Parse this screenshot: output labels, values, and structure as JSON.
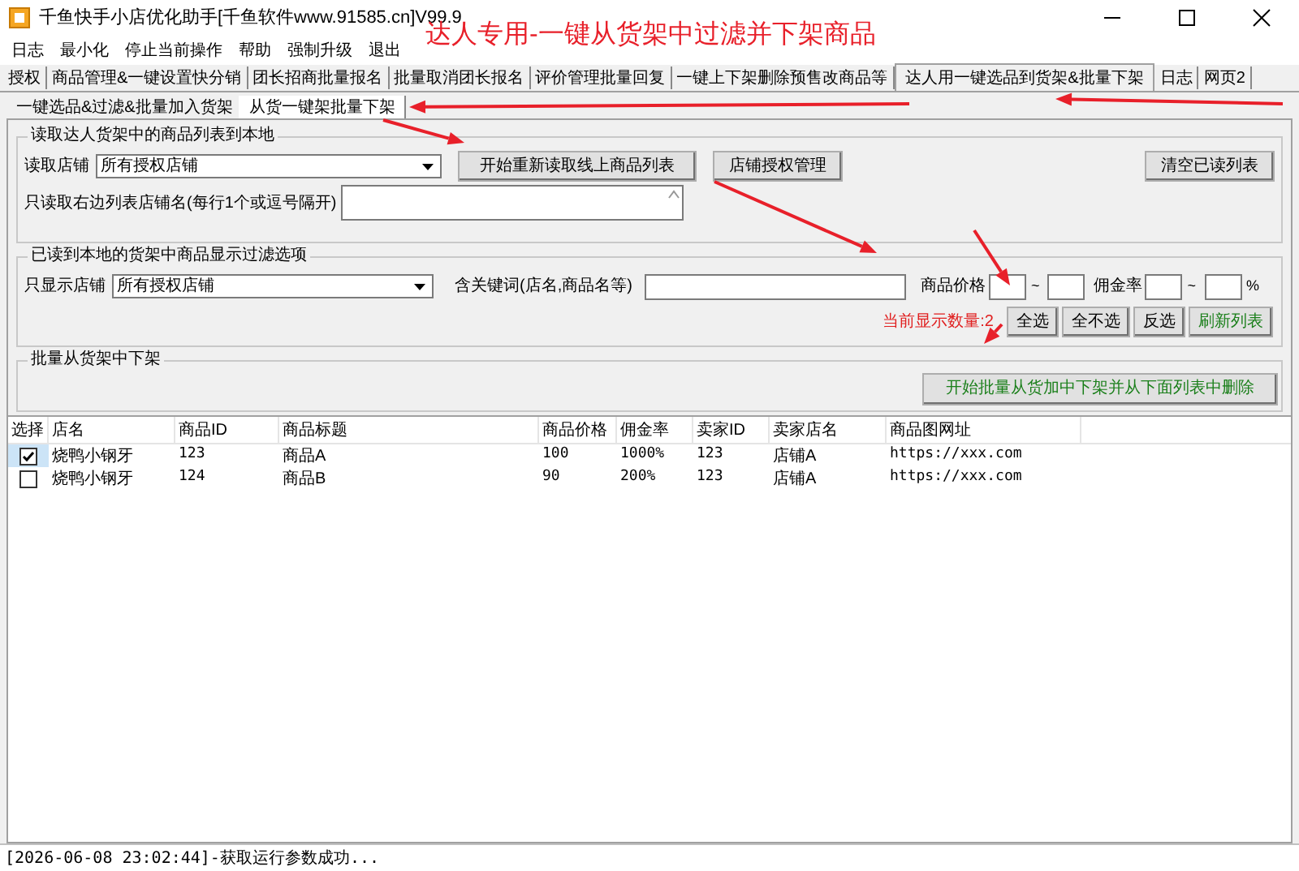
{
  "window": {
    "title": "千鱼快手小店优化助手[千鱼软件www.91585.cn]V99.9"
  },
  "annotation": "达人专用-一键从货架中过滤并下架商品",
  "menu": [
    "日志",
    "最小化",
    "停止当前操作",
    "帮助",
    "强制升级",
    "退出"
  ],
  "tabs": [
    {
      "label": "授权",
      "selected": false
    },
    {
      "label": "商品管理&一键设置快分销",
      "selected": false
    },
    {
      "label": "团长招商批量报名",
      "selected": false
    },
    {
      "label": "批量取消团长报名",
      "selected": false
    },
    {
      "label": "评价管理批量回复",
      "selected": false
    },
    {
      "label": "一键上下架删除预售改商品等",
      "selected": false
    },
    {
      "label": "达人用一键选品到货架&批量下架",
      "selected": true
    },
    {
      "label": "日志",
      "selected": false
    },
    {
      "label": "网页2",
      "selected": false
    }
  ],
  "subtabs": [
    {
      "label": "一键选品&过滤&批量加入货架",
      "selected": false
    },
    {
      "label": "从货一键架批量下架",
      "selected": true
    }
  ],
  "read_group": {
    "title": "读取达人货架中的商品列表到本地",
    "shop_label": "读取店铺",
    "shop_value": "所有授权店铺",
    "read_button": "开始重新读取线上商品列表",
    "auth_button": "店铺授权管理",
    "clear_button": "清空已读列表",
    "names_label": "只读取右边列表店铺名(每行1个或逗号隔开)"
  },
  "filter_group": {
    "title": "已读到本地的货架中商品显示过滤选项",
    "shop_label": "只显示店铺",
    "shop_value": "所有授权店铺",
    "keyword_label": "含关键词(店名,商品名等)",
    "price_label": "商品价格",
    "price_sep": "~",
    "commission_label": "佣金率",
    "commission_sep": "~",
    "percent": "%",
    "count_text": "当前显示数量:2",
    "buttons": [
      {
        "label": "全选",
        "kind": "plain"
      },
      {
        "label": "全不选",
        "kind": "plain"
      },
      {
        "label": "反选",
        "kind": "plain"
      },
      {
        "label": "刷新列表",
        "kind": "green"
      }
    ]
  },
  "delist_group": {
    "title": "批量从货架中下架",
    "button": "开始批量从货加中下架并从下面列表中删除"
  },
  "table": {
    "columns": [
      "选择",
      "店名",
      "商品ID",
      "商品标题",
      "商品价格",
      "佣金率",
      "卖家ID",
      "卖家店名",
      "商品图网址"
    ],
    "rows": [
      {
        "checked": true,
        "cells": [
          "",
          "烧鸭小钢牙",
          "123",
          "商品A",
          "100",
          "1000%",
          "123",
          "店铺A",
          "https://xxx.com"
        ]
      },
      {
        "checked": false,
        "cells": [
          "",
          "烧鸭小钢牙",
          "124",
          "商品B",
          "90",
          "200%",
          "123",
          "店铺A",
          "https://xxx.com"
        ]
      }
    ]
  },
  "status_bar": "[2026-06-08 23:02:44]-获取运行参数成功..."
}
